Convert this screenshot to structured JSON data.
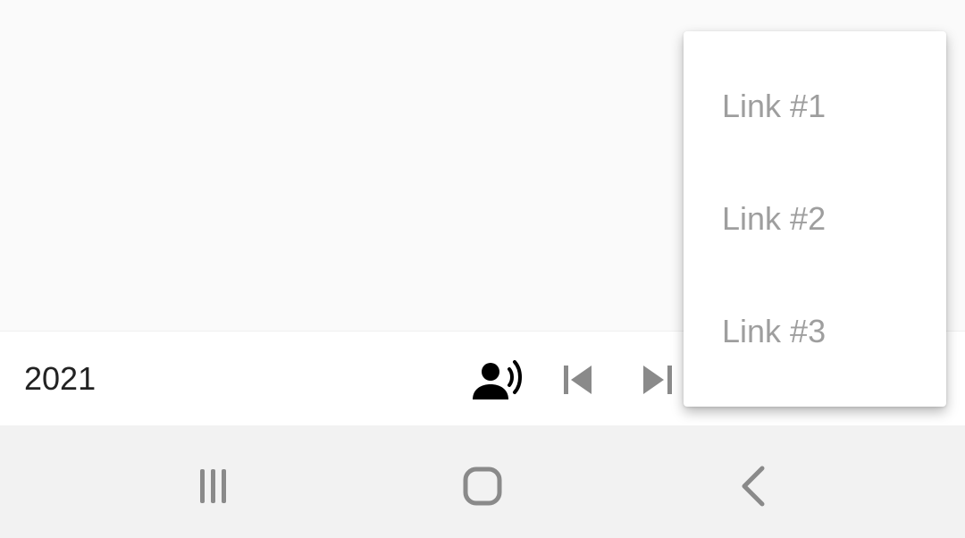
{
  "toolbar": {
    "year": "2021",
    "icons": [
      "record-voice-icon",
      "skip-previous-icon",
      "skip-next-icon"
    ]
  },
  "menu": {
    "items": [
      {
        "label": "Link #1"
      },
      {
        "label": "Link #2"
      },
      {
        "label": "Link #3"
      }
    ]
  },
  "navbar": {
    "icons": [
      "recents-icon",
      "home-icon",
      "back-icon"
    ]
  },
  "colors": {
    "background": "#fafafa",
    "toolbar": "#ffffff",
    "navbar": "#f2f2f2",
    "menu_text": "#9e9e9e",
    "year_text": "#222222",
    "icon_gray": "#8a8a8a",
    "icon_black": "#000000"
  }
}
